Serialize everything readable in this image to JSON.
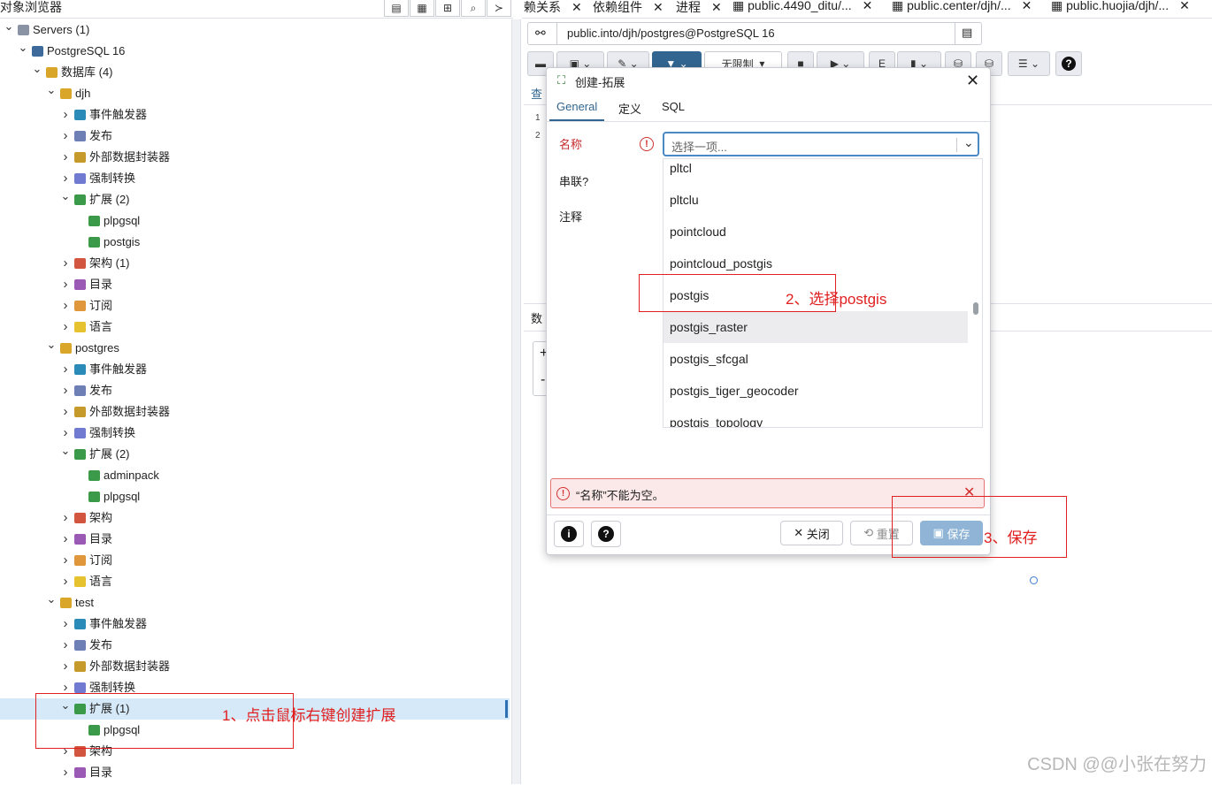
{
  "browser": {
    "title": "对象浏览器",
    "header_icons": [
      "database-icon",
      "table-icon",
      "filter-table-icon",
      "search-icon",
      "terminal-icon"
    ]
  },
  "tree": [
    {
      "indent": 0,
      "chevron": "down",
      "icon": "servers",
      "label": "Servers (1)"
    },
    {
      "indent": 1,
      "chevron": "down",
      "icon": "postgres",
      "label": "PostgreSQL 16"
    },
    {
      "indent": 2,
      "chevron": "down",
      "icon": "db",
      "label": "数据库 (4)"
    },
    {
      "indent": 3,
      "chevron": "down",
      "icon": "db",
      "label": "djh"
    },
    {
      "indent": 4,
      "chevron": "right",
      "icon": "trigger",
      "label": "事件触发器"
    },
    {
      "indent": 4,
      "chevron": "right",
      "icon": "publish",
      "label": "发布"
    },
    {
      "indent": 4,
      "chevron": "right",
      "icon": "fdw",
      "label": "外部数据封装器"
    },
    {
      "indent": 4,
      "chevron": "right",
      "icon": "cast",
      "label": "强制转换"
    },
    {
      "indent": 4,
      "chevron": "down",
      "icon": "ext",
      "label": "扩展 (2)"
    },
    {
      "indent": 5,
      "chevron": "",
      "icon": "ext",
      "label": "plpgsql"
    },
    {
      "indent": 5,
      "chevron": "",
      "icon": "ext",
      "label": "postgis"
    },
    {
      "indent": 4,
      "chevron": "right",
      "icon": "schema",
      "label": "架构 (1)"
    },
    {
      "indent": 4,
      "chevron": "right",
      "icon": "catalog",
      "label": "目录"
    },
    {
      "indent": 4,
      "chevron": "right",
      "icon": "sub",
      "label": "订阅"
    },
    {
      "indent": 4,
      "chevron": "right",
      "icon": "lang",
      "label": "语言"
    },
    {
      "indent": 3,
      "chevron": "down",
      "icon": "db",
      "label": "postgres"
    },
    {
      "indent": 4,
      "chevron": "right",
      "icon": "trigger",
      "label": "事件触发器"
    },
    {
      "indent": 4,
      "chevron": "right",
      "icon": "publish",
      "label": "发布"
    },
    {
      "indent": 4,
      "chevron": "right",
      "icon": "fdw",
      "label": "外部数据封装器"
    },
    {
      "indent": 4,
      "chevron": "right",
      "icon": "cast",
      "label": "强制转换"
    },
    {
      "indent": 4,
      "chevron": "down",
      "icon": "ext",
      "label": "扩展 (2)"
    },
    {
      "indent": 5,
      "chevron": "",
      "icon": "ext",
      "label": "adminpack"
    },
    {
      "indent": 5,
      "chevron": "",
      "icon": "ext",
      "label": "plpgsql"
    },
    {
      "indent": 4,
      "chevron": "right",
      "icon": "schema",
      "label": "架构"
    },
    {
      "indent": 4,
      "chevron": "right",
      "icon": "catalog",
      "label": "目录"
    },
    {
      "indent": 4,
      "chevron": "right",
      "icon": "sub",
      "label": "订阅"
    },
    {
      "indent": 4,
      "chevron": "right",
      "icon": "lang",
      "label": "语言"
    },
    {
      "indent": 3,
      "chevron": "down",
      "icon": "db",
      "label": "test"
    },
    {
      "indent": 4,
      "chevron": "right",
      "icon": "trigger",
      "label": "事件触发器"
    },
    {
      "indent": 4,
      "chevron": "right",
      "icon": "publish",
      "label": "发布"
    },
    {
      "indent": 4,
      "chevron": "right",
      "icon": "fdw",
      "label": "外部数据封装器"
    },
    {
      "indent": 4,
      "chevron": "right",
      "icon": "cast",
      "label": "强制转换"
    },
    {
      "indent": 4,
      "chevron": "down",
      "icon": "ext",
      "label": "扩展 (1)",
      "selected": true
    },
    {
      "indent": 5,
      "chevron": "",
      "icon": "ext",
      "label": "plpgsql"
    },
    {
      "indent": 4,
      "chevron": "right",
      "icon": "schema",
      "label": "架构"
    },
    {
      "indent": 4,
      "chevron": "right",
      "icon": "catalog",
      "label": "目录"
    }
  ],
  "tabs": [
    "赖关系",
    "依赖组件",
    "进程",
    "public.4490_ditu/...",
    "public.center/djh/...",
    "public.huojia/djh/..."
  ],
  "connection": {
    "text": "public.into/djh/postgres@PostgreSQL 16"
  },
  "toolbar": {
    "limit_label": "无限制"
  },
  "editor": {
    "line_numbers": [
      "1",
      "2"
    ],
    "tab_partial": "查",
    "results_partial": "数"
  },
  "dialog": {
    "title": "创建-拓展",
    "tabs": [
      "General",
      "定义",
      "SQL"
    ],
    "fields": {
      "name": "名称",
      "cascade": "串联?",
      "comment": "注释"
    },
    "select_placeholder": "选择一项...",
    "options": [
      "pltcl",
      "pltclu",
      "pointcloud",
      "pointcloud_postgis",
      "postgis",
      "postgis_raster",
      "postgis_sfcgal",
      "postgis_tiger_geocoder",
      "postgis_topology"
    ],
    "hovered_option": "postgis_raster",
    "error_message": "“名称”不能为空。",
    "buttons": {
      "close": "关闭",
      "reset": "重置",
      "save": "保存"
    }
  },
  "annotations": {
    "step1": "1、点击鼠标右键创建扩展",
    "step2": "2、选择postgis",
    "step3": "3、保存"
  },
  "watermark": "CSDN @@小张在努力",
  "colors": {
    "accent": "#326690",
    "error": "#d32f2f",
    "annotation": "#e02020",
    "selected_row": "#d6e9f8"
  }
}
